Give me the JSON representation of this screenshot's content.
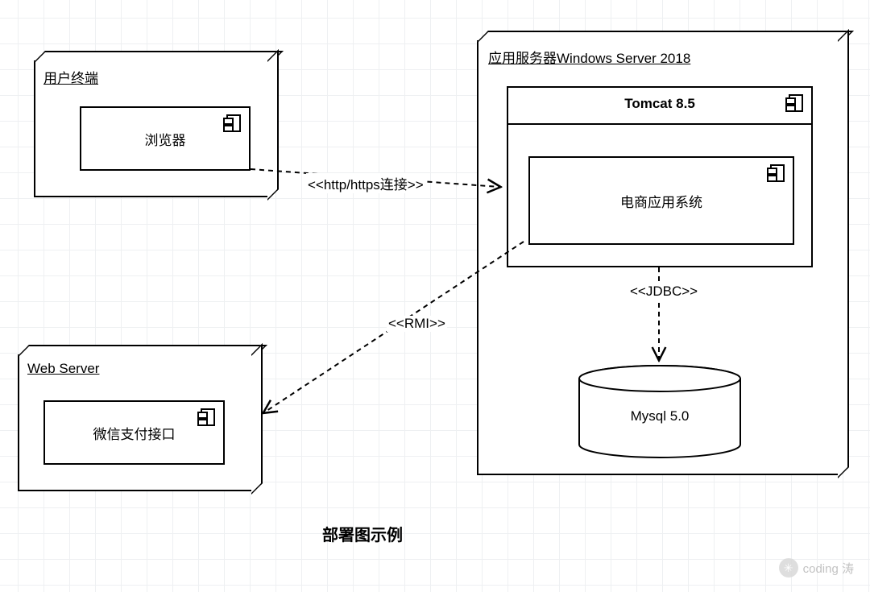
{
  "nodes": {
    "client": {
      "title": "用户终端",
      "component": "浏览器"
    },
    "appserver": {
      "title": "应用服务器Windows Server 2018",
      "tomcat": "Tomcat 8.5",
      "app": "电商应用系统",
      "db": "Mysql 5.0"
    },
    "webserver": {
      "title": "Web Server",
      "component": "微信支付接口"
    }
  },
  "connections": {
    "http": "<<http/https连接>>",
    "jdbc": "<<JDBC>>",
    "rmi": "<<RMI>>"
  },
  "caption": "部署图示例",
  "watermark": "coding 涛"
}
